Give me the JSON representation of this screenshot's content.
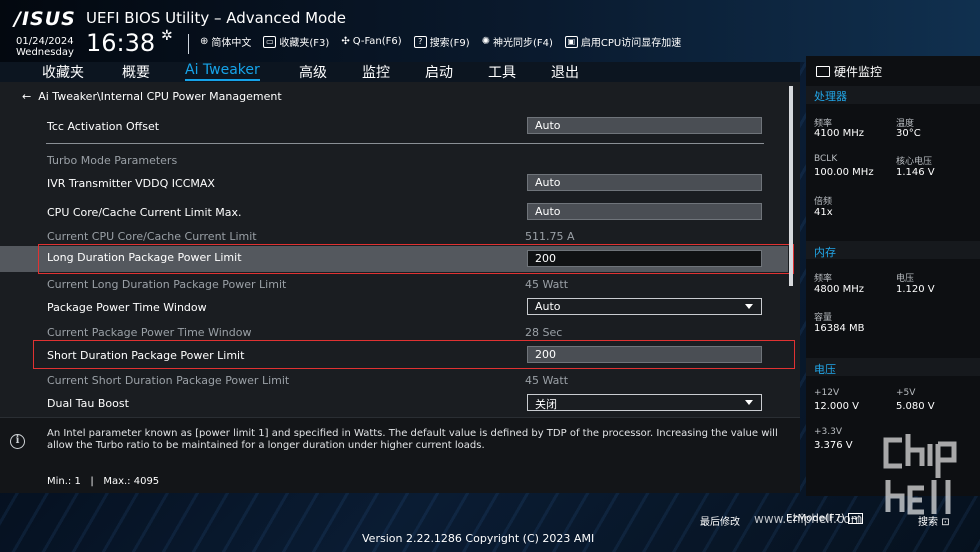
{
  "header": {
    "brand": "/ISUS",
    "title": "UEFI BIOS Utility – Advanced Mode",
    "date": "01/24/2024",
    "weekday": "Wednesday",
    "time": "16:38",
    "tools": [
      {
        "icon": "globe-icon",
        "label": "简体中文"
      },
      {
        "icon": "favorites-icon",
        "label": "收藏夹(F3)"
      },
      {
        "icon": "fan-icon",
        "label": "Q-Fan(F6)"
      },
      {
        "icon": "help-search-icon",
        "label": "搜索(F9)"
      },
      {
        "icon": "aura-icon",
        "label": "神光同步(F4)"
      },
      {
        "icon": "resize-bar-icon",
        "label": "启用CPU访问显存加速"
      }
    ]
  },
  "nav": {
    "tabs": [
      "收藏夹",
      "概要",
      "Ai Tweaker",
      "高级",
      "监控",
      "启动",
      "工具",
      "退出"
    ],
    "active": "Ai Tweaker"
  },
  "main": {
    "breadcrumb": "Ai Tweaker\\Internal CPU Power Management",
    "rows": [
      {
        "label": "Tcc Activation Offset",
        "value": "Auto",
        "kind": "box"
      },
      {
        "label": "Turbo Mode Parameters",
        "kind": "section"
      },
      {
        "label": "IVR Transmitter VDDQ ICCMAX",
        "value": "Auto",
        "kind": "box"
      },
      {
        "label": "CPU Core/Cache Current Limit Max.",
        "value": "Auto",
        "kind": "box"
      },
      {
        "label": "Current CPU Core/Cache Current Limit",
        "value": "511.75 A",
        "kind": "info"
      },
      {
        "label": "Long Duration Package Power Limit",
        "value": "200",
        "kind": "selected"
      },
      {
        "label": "Current Long Duration Package Power Limit",
        "value": "45 Watt",
        "kind": "info"
      },
      {
        "label": "Package Power Time Window",
        "value": "Auto",
        "kind": "dropdown"
      },
      {
        "label": "Current Package Power Time Window",
        "value": "28 Sec",
        "kind": "info"
      },
      {
        "label": "Short Duration Package Power Limit",
        "value": "200",
        "kind": "box"
      },
      {
        "label": "Current Short Duration Package Power Limit",
        "value": "45 Watt",
        "kind": "info"
      },
      {
        "label": "Dual Tau Boost",
        "value": "关闭",
        "kind": "dropdown"
      }
    ]
  },
  "help": {
    "text": "An Intel parameter known as [power limit 1] and specified in Watts. The default value is defined by TDP of the processor. Increasing the value will allow the Turbo ratio to be maintained for a longer duration under higher current loads.",
    "min": "Min.: 1",
    "sep": "|",
    "max": "Max.: 4095"
  },
  "monitor": {
    "title": "硬件监控",
    "cpu": {
      "section": "处理器",
      "freq_k": "频率",
      "freq_v": "4100 MHz",
      "temp_k": "温度",
      "temp_v": "30°C",
      "bclk_k": "BCLK",
      "bclk_v": "100.00 MHz",
      "vcore_k": "核心电压",
      "vcore_v": "1.146 V",
      "ratio_k": "倍频",
      "ratio_v": "41x"
    },
    "mem": {
      "section": "内存",
      "freq_k": "频率",
      "freq_v": "4800 MHz",
      "volt_k": "电压",
      "volt_v": "1.120 V",
      "cap_k": "容量",
      "cap_v": "16384 MB"
    },
    "volt": {
      "section": "电压",
      "v12_k": "+12V",
      "v12_v": "12.000 V",
      "v5_k": "+5V",
      "v5_v": "5.080 V",
      "v33_k": "+3.3V",
      "v33_v": "3.376 V"
    }
  },
  "footer": {
    "version": "Version 2.22.1286 Copyright (C) 2023 AMI",
    "last_modified": "最后修改",
    "ezmode": "EzMode(F7)",
    "ezkey": "→|",
    "search": "搜索",
    "watermark": "www.chiphell.com"
  }
}
